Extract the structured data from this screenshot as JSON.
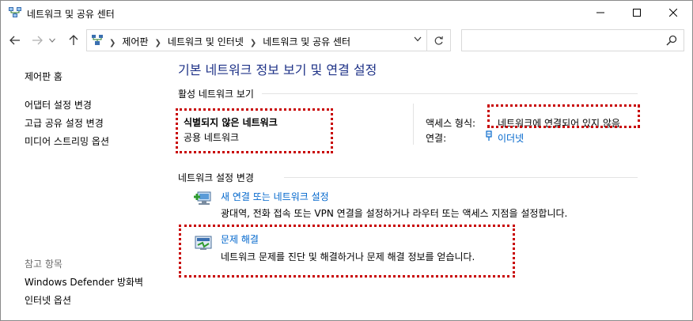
{
  "window": {
    "title": "네트워크 및 공유 센터"
  },
  "nav": {
    "breadcrumbs": [
      "제어판",
      "네트워크 및 인터넷",
      "네트워크 및 공유 센터"
    ],
    "search_placeholder": ""
  },
  "sidebar": {
    "home": "제어판 홈",
    "links": [
      "어댑터 설정 변경",
      "고급 공유 설정 변경",
      "미디어 스트리밍 옵션"
    ],
    "see_also_header": "참고 항목",
    "see_also": [
      "Windows Defender 방화벽",
      "인터넷 옵션"
    ]
  },
  "main": {
    "title": "기본 네트워크 정보 보기 및 연결 설정",
    "active_section": "활성 네트워크 보기",
    "network": {
      "name": "식별되지 않은 네트워크",
      "type": "공용 네트워크",
      "access_label": "액세스 형식:",
      "access_value": "네트워크에 연결되어 있지 않음",
      "connection_label": "연결:",
      "connection_value": "이더넷"
    },
    "change_section": "네트워크 설정 변경",
    "tasks": [
      {
        "title": "새 연결 또는 네트워크 설정",
        "desc": "광대역, 전화 접속 또는 VPN 연결을 설정하거나 라우터 또는 액세스 지점을 설정합니다."
      },
      {
        "title": "문제 해결",
        "desc": "네트워크 문제를 진단 및 해결하거나 문제 해결 정보를 얻습니다."
      }
    ]
  },
  "colors": {
    "title_blue": "#1e3287",
    "link_blue": "#0066cc",
    "highlight_red": "#c80000"
  }
}
